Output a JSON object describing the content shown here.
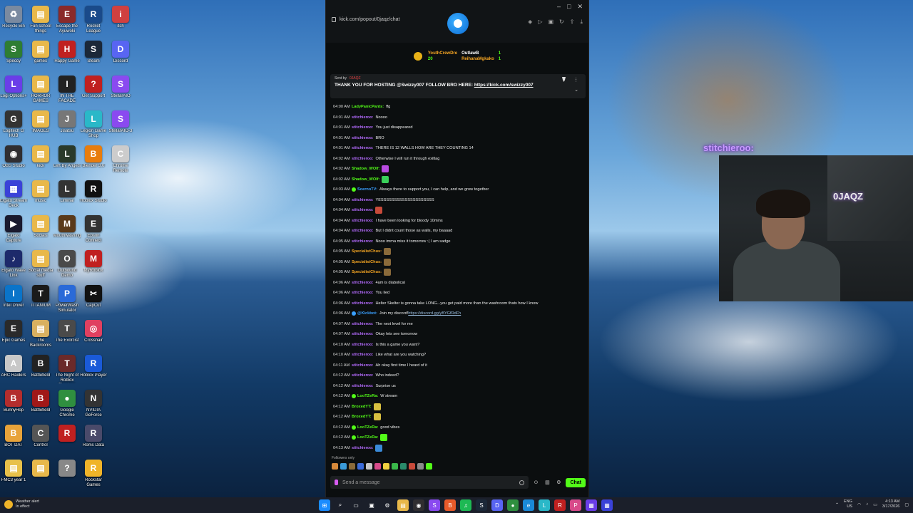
{
  "desktop": {
    "col1": [
      {
        "label": "Recycle Bin",
        "color": "#7a8aa0",
        "glyph": "♻"
      },
      {
        "label": "Speccy",
        "color": "#2e7d32",
        "glyph": "S"
      },
      {
        "label": "Logi Options+",
        "color": "#6a3de8",
        "glyph": "L"
      },
      {
        "label": "Logitech G HUB",
        "color": "#333333",
        "glyph": "G"
      },
      {
        "label": "OBS Studio",
        "color": "#302e31",
        "glyph": "◉"
      },
      {
        "label": "Elgato Stream Deck",
        "color": "#3a42d8",
        "glyph": "▦"
      },
      {
        "label": "Elgato Capture",
        "color": "#1a1a2e",
        "glyph": "▶"
      },
      {
        "label": "Elgato Wave Link",
        "color": "#1d2a6b",
        "glyph": "♪"
      },
      {
        "label": "Intel Driver",
        "color": "#0a74c9",
        "glyph": "I"
      },
      {
        "label": "Epic Games",
        "color": "#2a2a2a",
        "glyph": "E"
      },
      {
        "label": "ARC Raiders",
        "color": "#c8c8c8",
        "glyph": "A"
      },
      {
        "label": "BunnyHop",
        "color": "#b32d2d",
        "glyph": "B"
      },
      {
        "label": "BOT DAT",
        "color": "#e8a33a",
        "glyph": "B"
      },
      {
        "label": "FMC3 year 1",
        "color": "#e8c14a",
        "glyph": "▤"
      }
    ],
    "col2": [
      {
        "label": "Fun school things",
        "color": "#e8b84a",
        "glyph": "▤"
      },
      {
        "label": "games",
        "color": "#e8b84a",
        "glyph": "▤"
      },
      {
        "label": "HORROR GAMES",
        "color": "#e8b84a",
        "glyph": "▤"
      },
      {
        "label": "IMAGES",
        "color": "#e8b84a",
        "glyph": "▤"
      },
      {
        "label": "kick",
        "color": "#e8b84a",
        "glyph": "▤"
      },
      {
        "label": "music",
        "color": "#e8b84a",
        "glyph": "▤"
      },
      {
        "label": "Socials",
        "color": "#e8b84a",
        "glyph": "▤"
      },
      {
        "label": "Social media stuff",
        "color": "#e8b84a",
        "glyph": "▤"
      },
      {
        "label": "TITANIUM",
        "color": "#1a1a1a",
        "glyph": "T"
      },
      {
        "label": "The Backrooms",
        "color": "#d8b060",
        "glyph": "▤"
      },
      {
        "label": "Battlefield",
        "color": "#222222",
        "glyph": "B"
      },
      {
        "label": "Battlefield",
        "color": "#a01818",
        "glyph": "B"
      },
      {
        "label": "Control",
        "color": "#555555",
        "glyph": "C"
      },
      {
        "label": "",
        "color": "#e8b84a",
        "glyph": "▤"
      }
    ],
    "col3": [
      {
        "label": "Escape the Ayuwoki",
        "color": "#8a2a2a",
        "glyph": "E"
      },
      {
        "label": "Happy Game",
        "color": "#c02020",
        "glyph": "H"
      },
      {
        "label": "IN THE FACADE",
        "color": "#222222",
        "glyph": "I"
      },
      {
        "label": "Jisatsu",
        "color": "#777777",
        "glyph": "J"
      },
      {
        "label": "Left By Angels",
        "color": "#2a3a2a",
        "glyph": "L"
      },
      {
        "label": "Liminal",
        "color": "#333333",
        "glyph": "L"
      },
      {
        "label": "Mouthwashing",
        "color": "#5a3a1a",
        "glyph": "M"
      },
      {
        "label": "Outbound Demo",
        "color": "#4a4a4a",
        "glyph": "O"
      },
      {
        "label": "PowerWash Simulator",
        "color": "#2a6ad8",
        "glyph": "P"
      },
      {
        "label": "The Exorcist",
        "color": "#4a4a4a",
        "glyph": "T"
      },
      {
        "label": "The Night of Roblox Phantom",
        "color": "#6a2a2a",
        "glyph": "T"
      },
      {
        "label": "Google Chrome",
        "color": "#2f8f3f",
        "glyph": "●"
      },
      {
        "label": "",
        "color": "#c02020",
        "glyph": "R"
      },
      {
        "label": "",
        "color": "#888888",
        "glyph": "?"
      }
    ],
    "col4": [
      {
        "label": "Rocket League",
        "color": "#1a4a8a",
        "glyph": "R"
      },
      {
        "label": "Steam",
        "color": "#1b2838",
        "glyph": "S"
      },
      {
        "label": "Get Support",
        "color": "#c02020",
        "glyph": "?"
      },
      {
        "label": "Legion Game Shop",
        "color": "#2ab8c8",
        "glyph": "L"
      },
      {
        "label": "Blender 3.0",
        "color": "#e87d0d",
        "glyph": "B"
      },
      {
        "label": "Roblox Studio",
        "color": "#111111",
        "glyph": "R"
      },
      {
        "label": "Epson Connect",
        "color": "#333333",
        "glyph": "E"
      },
      {
        "label": "MyRoblox",
        "color": "#c02020",
        "glyph": "M"
      },
      {
        "label": "CapCut",
        "color": "#111111",
        "glyph": "✂"
      },
      {
        "label": "Crosshair",
        "color": "#e04060",
        "glyph": "◎"
      },
      {
        "label": "Roblox Player",
        "color": "#1a5ad8",
        "glyph": "R"
      },
      {
        "label": "NVIDIA GeForce",
        "color": "#333333",
        "glyph": "N"
      },
      {
        "label": "Roms Data",
        "color": "#4a4a6a",
        "glyph": "R"
      },
      {
        "label": "Rockstar Games",
        "color": "#f0b429",
        "glyph": "R"
      }
    ],
    "col5": [
      {
        "label": "itch",
        "color": "#d04040",
        "glyph": "i"
      },
      {
        "label": "Discord",
        "color": "#5865f2",
        "glyph": "D"
      },
      {
        "label": "StellarAIO",
        "color": "#8a4af0",
        "glyph": "S"
      },
      {
        "label": "StellarAIO-3",
        "color": "#8a4af0",
        "glyph": "S"
      },
      {
        "label": "Chrome Remote",
        "color": "#cccccc",
        "glyph": "C"
      }
    ]
  },
  "chat_window": {
    "url": "kick.com/popout/0jaqz/chat",
    "controls": [
      "–",
      "□",
      "✕"
    ],
    "leaderboard": {
      "left_name": "YouthCrewDre",
      "left_count": "20",
      "right_top_name": "OutlawB",
      "right_top_count": "1",
      "right_bottom_name": "ReihanaMgkako",
      "right_bottom_count": "1"
    },
    "pinned": {
      "sent_by_label": "Sent by",
      "sender": "0JAQZ",
      "text": "THANK YOU FOR HOSTING @Swizzy007 FOLLOW BRO HERE: ",
      "link": "https://kick.com/swizzy007"
    },
    "messages": [
      {
        "time": "04:00 AM",
        "user": "LadyPanicPants:",
        "color": "#53fc18",
        "text": "ffg",
        "badge": "",
        "emote": ""
      },
      {
        "time": "04:01 AM",
        "user": "stitchieroo:",
        "color": "#b56bff",
        "text": "Noooo",
        "badge": "",
        "emote": ""
      },
      {
        "time": "04:01 AM",
        "user": "stitchieroo:",
        "color": "#b56bff",
        "text": "You just disappeared",
        "badge": "",
        "emote": ""
      },
      {
        "time": "04:01 AM",
        "user": "stitchieroo:",
        "color": "#b56bff",
        "text": "BRO",
        "badge": "",
        "emote": ""
      },
      {
        "time": "04:01 AM",
        "user": "stitchieroo:",
        "color": "#b56bff",
        "text": "THERE IS 12 WALLS HOW ARE THEY COUNTING 14",
        "badge": "",
        "emote": ""
      },
      {
        "time": "04:02 AM",
        "user": "stitchieroo:",
        "color": "#b56bff",
        "text": "Otherwise I will run it through exitlag",
        "badge": "",
        "emote": ""
      },
      {
        "time": "04:02 AM",
        "user": "Shadow_WOlf:",
        "color": "#53fc18",
        "text": "",
        "badge": "",
        "emote": "#b84ae0"
      },
      {
        "time": "04:02 AM",
        "user": "Shadow_WOlf:",
        "color": "#53fc18",
        "text": "",
        "badge": "",
        "emote": "#3ad05a"
      },
      {
        "time": "04:03 AM",
        "user": "SoernoTV:",
        "color": "#3aa0ff",
        "text": "Always there to support you, I can help, and we grow together",
        "badge": "#53fc18",
        "emote": ""
      },
      {
        "time": "04:04 AM",
        "user": "stitchieroo:",
        "color": "#b56bff",
        "text": "YESSSSSSSSSSSSSSSSSSSS",
        "badge": "",
        "emote": ""
      },
      {
        "time": "04:04 AM",
        "user": "stitchieroo:",
        "color": "#b56bff",
        "text": "",
        "badge": "",
        "emote": "#c84a3a"
      },
      {
        "time": "04:04 AM",
        "user": "stitchieroo:",
        "color": "#b56bff",
        "text": "I have been looking for bloody 10mins",
        "badge": "",
        "emote": ""
      },
      {
        "time": "04:04 AM",
        "user": "stitchieroo:",
        "color": "#b56bff",
        "text": "But I didnt count those as walls, my baaaad",
        "badge": "",
        "emote": ""
      },
      {
        "time": "04:05 AM",
        "user": "stitchieroo:",
        "color": "#b56bff",
        "text": "Nooo imma miss it tomorrow :( I am sadge",
        "badge": "",
        "emote": ""
      },
      {
        "time": "04:05 AM",
        "user": "SpecialistChus:",
        "color": "#f6a623",
        "text": "",
        "badge": "",
        "emote": "#8a6a3a"
      },
      {
        "time": "04:05 AM",
        "user": "SpecialistChus:",
        "color": "#f6a623",
        "text": "",
        "badge": "",
        "emote": "#8a6a3a"
      },
      {
        "time": "04:05 AM",
        "user": "SpecialistChus:",
        "color": "#f6a623",
        "text": "",
        "badge": "",
        "emote": "#8a6a3a"
      },
      {
        "time": "04:06 AM",
        "user": "stitchieroo:",
        "color": "#b56bff",
        "text": "4am is diabolical",
        "badge": "",
        "emote": ""
      },
      {
        "time": "04:06 AM",
        "user": "stitchieroo:",
        "color": "#b56bff",
        "text": "You lied",
        "badge": "",
        "emote": ""
      },
      {
        "time": "04:06 AM",
        "user": "stitchieroo:",
        "color": "#b56bff",
        "text": "Helter Skelter is gonna take LONG...you get paid more than the washroom thats how I know",
        "badge": "",
        "emote": ""
      },
      {
        "time": "04:06 AM",
        "user": "@Kickbot:",
        "color": "#3aa0ff",
        "text": "Join my discord! ",
        "link": "https://discord.gg/yBYGfRdFh",
        "badge": "#3aa0ff",
        "emote": ""
      },
      {
        "time": "04:07 AM",
        "user": "stitchieroo:",
        "color": "#b56bff",
        "text": "The next level for me",
        "badge": "",
        "emote": ""
      },
      {
        "time": "04:07 AM",
        "user": "stitchieroo:",
        "color": "#b56bff",
        "text": "Okay lets see tomorrow",
        "badge": "",
        "emote": ""
      },
      {
        "time": "04:10 AM",
        "user": "stitchieroo:",
        "color": "#b56bff",
        "text": "Is this a game you want?",
        "badge": "",
        "emote": ""
      },
      {
        "time": "04:10 AM",
        "user": "stitchieroo:",
        "color": "#b56bff",
        "text": "Like what are you watching?",
        "badge": "",
        "emote": ""
      },
      {
        "time": "04:11 AM",
        "user": "stitchieroo:",
        "color": "#b56bff",
        "text": "Ah okay first time I heard of it",
        "badge": "",
        "emote": ""
      },
      {
        "time": "04:12 AM",
        "user": "stitchieroo:",
        "color": "#b56bff",
        "text": "Who indeed?",
        "badge": "",
        "emote": ""
      },
      {
        "time": "04:12 AM",
        "user": "stitchieroo:",
        "color": "#b56bff",
        "text": "Surprise us",
        "badge": "",
        "emote": ""
      },
      {
        "time": "04:12 AM",
        "user": "LooTZeRa:",
        "color": "#53fc18",
        "text": "W stream",
        "badge": "#53fc18",
        "emote": ""
      },
      {
        "time": "04:12 AM",
        "user": "BroxedYT:",
        "color": "#53fc18",
        "text": "",
        "badge": "",
        "emote": "#d8c040"
      },
      {
        "time": "04:12 AM",
        "user": "BroxedYT:",
        "color": "#53fc18",
        "text": "",
        "badge": "",
        "emote": "#d8c040"
      },
      {
        "time": "04:12 AM",
        "user": "LooTZeRa:",
        "color": "#53fc18",
        "text": "good vibes",
        "badge": "#53fc18",
        "emote": ""
      },
      {
        "time": "04:12 AM",
        "user": "LooTZeRa:",
        "color": "#53fc18",
        "text": "",
        "badge": "#53fc18",
        "emote": "#53fc18"
      },
      {
        "time": "04:13 AM",
        "user": "stitchieroo:",
        "color": "#b56bff",
        "text": "",
        "badge": "",
        "emote": "#3a8ad8"
      }
    ],
    "followers_label": "Followers only",
    "emote_bar": [
      "#d88a3a",
      "#3a9ad8",
      "#8a6a3a",
      "#3a6ad8",
      "#c8c8c8",
      "#d84a8a",
      "#f0d040",
      "#3ab84a",
      "#2a8a6a",
      "#c84a3a",
      "#8a8a8a",
      "#53fc18"
    ],
    "input_placeholder": "Send a message",
    "chat_button": "Chat"
  },
  "overlay": {
    "streamer_name": "stitchieroo:",
    "cam_sign": "0JAQZ"
  },
  "taskbar": {
    "weather_title": "Weather alert",
    "weather_sub": "In effect",
    "apps": [
      {
        "name": "start",
        "color": "#1a8cff",
        "glyph": "⊞"
      },
      {
        "name": "search",
        "color": "#1b1f2a",
        "glyph": "⌕"
      },
      {
        "name": "task-view",
        "color": "#1b1f2a",
        "glyph": "▭"
      },
      {
        "name": "widgets",
        "color": "#1b1f2a",
        "glyph": "▣"
      },
      {
        "name": "settings",
        "color": "#1b1f2a",
        "glyph": "⚙"
      },
      {
        "name": "explorer",
        "color": "#e8b84a",
        "glyph": "▤"
      },
      {
        "name": "obs",
        "color": "#302e31",
        "glyph": "◉"
      },
      {
        "name": "stellar",
        "color": "#8a4af0",
        "glyph": "S"
      },
      {
        "name": "brave",
        "color": "#e85a2a",
        "glyph": "B"
      },
      {
        "name": "spotify",
        "color": "#1db954",
        "glyph": "♫"
      },
      {
        "name": "steam",
        "color": "#1b2838",
        "glyph": "S"
      },
      {
        "name": "discord",
        "color": "#5865f2",
        "glyph": "D"
      },
      {
        "name": "chrome",
        "color": "#2f8f3f",
        "glyph": "●"
      },
      {
        "name": "edge",
        "color": "#1a8ad8",
        "glyph": "e"
      },
      {
        "name": "app1",
        "color": "#2ab8c8",
        "glyph": "L"
      },
      {
        "name": "app2",
        "color": "#c02020",
        "glyph": "R"
      },
      {
        "name": "app3",
        "color": "#d84a8a",
        "glyph": "P"
      },
      {
        "name": "app4",
        "color": "#6a3de8",
        "glyph": "▦"
      },
      {
        "name": "app5",
        "color": "#3a42d8",
        "glyph": "▦"
      }
    ],
    "lang": "ENG",
    "region": "US",
    "time": "4:13 AM",
    "date": "3/17/2026"
  }
}
